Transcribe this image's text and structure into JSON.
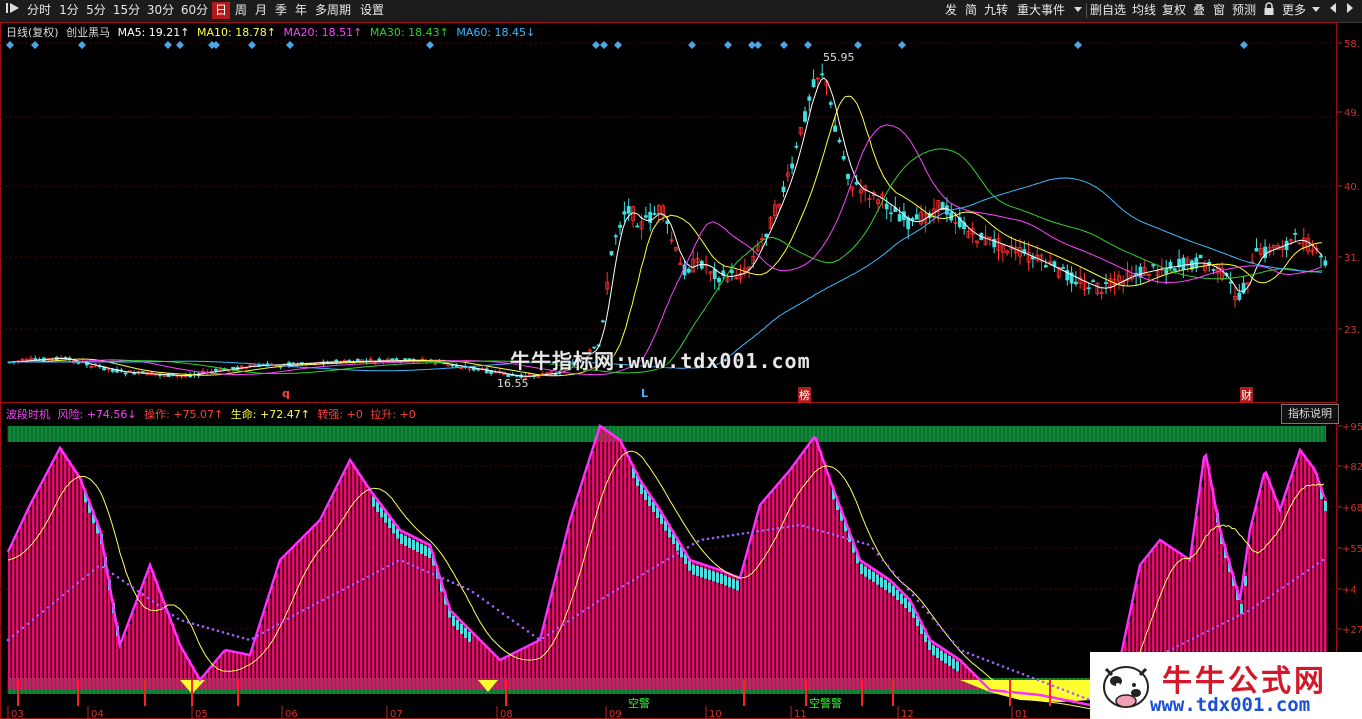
{
  "toolbar": {
    "left_icon": "play-icon",
    "periods": [
      "分时",
      "1分",
      "5分",
      "15分",
      "30分",
      "60分",
      "日",
      "周",
      "月",
      "季",
      "年",
      "多周期",
      "设置"
    ],
    "active_period": "日",
    "right_buttons": [
      "发",
      "简",
      "九转",
      "重大事件"
    ],
    "right_buttons2": [
      "删自选",
      "均线",
      "复权",
      "叠",
      "窗",
      "预测"
    ],
    "more_label": "更多"
  },
  "main_chart": {
    "title": "日线(复权)",
    "name": "创业黑马",
    "ma5": "MA5: 19.21↑",
    "ma10": "MA10: 18.78↑",
    "ma20": "MA20: 18.51↑",
    "ma30": "MA30: 18.43↑",
    "ma60": "MA60: 18.45↓",
    "high_label": "55.95",
    "low_label": "16.55",
    "price_ticks": [
      "58.",
      "49.",
      "40.",
      "31.",
      "23."
    ],
    "markers": [
      "q",
      "L",
      "榜",
      "财"
    ],
    "watermark": "牛牛指标网:www.tdx001.com"
  },
  "indicator": {
    "name": "波段时机",
    "risk": "风险: +74.56↓",
    "operate": "操作: +75.07↑",
    "life": "生命: +72.47↑",
    "strong": "转强: +0",
    "pull": "拉升: +0",
    "help_button": "指标说明",
    "right_ticks": [
      "+95",
      "+82",
      "+68",
      "+55",
      "+4",
      "+27"
    ],
    "labels": [
      "空警",
      "空警警"
    ]
  },
  "x_axis": [
    "03",
    "04",
    "05",
    "06",
    "07",
    "08",
    "09",
    "10",
    "11",
    "12",
    "01"
  ],
  "logo": {
    "title": "牛牛公式网",
    "url": "www.tdx001.com"
  },
  "colors": {
    "ma5": "#ffffff",
    "ma10": "#ffff40",
    "ma20": "#ff40ff",
    "ma30": "#30d030",
    "ma60": "#40b8ff",
    "up": "#ff3030",
    "down": "#40e0e0",
    "ind_fill": "#e0106a",
    "ind_border": "#ff30ff",
    "green_band": "#108a3a"
  },
  "chart_data": [
    {
      "type": "candlestick",
      "title": "日线(复权) 创业黑马",
      "x": [
        "03",
        "04",
        "05",
        "06",
        "07",
        "08",
        "09",
        "10",
        "11",
        "12",
        "01"
      ],
      "ylim": [
        16.55,
        58
      ],
      "series": [
        {
          "name": "close",
          "values": [
            19.5,
            19.2,
            18.6,
            19.4,
            19.8,
            17.5,
            22.0,
            40.5,
            28.0,
            50.0,
            38.5,
            32.0,
            31.0,
            30.2,
            31.5
          ]
        },
        {
          "name": "MA5",
          "values": [
            19.2,
            19.0,
            18.7,
            19.2,
            19.6,
            18.2,
            21.0,
            36.0,
            30.0,
            45.0,
            40.0,
            32.5,
            31.0,
            30.5,
            31.0
          ]
        },
        {
          "name": "MA60",
          "values": [
            19.0,
            19.0,
            19.0,
            19.1,
            19.3,
            18.8,
            19.2,
            23.0,
            27.0,
            33.0,
            38.0,
            38.0,
            36.0,
            32.5,
            31.0
          ]
        }
      ],
      "annotations": [
        "55.95",
        "16.55"
      ]
    },
    {
      "type": "bar",
      "title": "波段时机",
      "x": [
        "03",
        "04",
        "05",
        "06",
        "07",
        "08",
        "09",
        "10",
        "11",
        "12",
        "01"
      ],
      "ylim": [
        0,
        95
      ],
      "series": [
        {
          "name": "风险",
          "values": [
            60,
            88,
            35,
            55,
            40,
            85,
            70,
            30,
            15,
            50,
            55,
            95,
            75,
            60,
            45,
            92,
            75,
            55,
            40,
            30,
            20,
            5,
            0,
            0,
            30,
            55,
            60,
            85,
            50,
            80,
            74.56
          ]
        },
        {
          "name": "操作",
          "values": [
            58,
            80,
            40,
            52,
            42,
            80,
            68,
            35,
            20,
            45,
            50,
            90,
            72,
            62,
            48,
            88,
            78,
            58,
            42,
            32,
            22,
            8,
            2,
            2,
            28,
            50,
            58,
            82,
            52,
            78,
            75.07
          ]
        },
        {
          "name": "生命",
          "values": [
            20,
            25,
            30,
            32,
            35,
            40,
            42,
            44,
            30,
            28,
            30,
            40,
            45,
            48,
            52,
            55,
            58,
            60,
            55,
            45,
            30,
            15,
            5,
            5,
            15,
            25,
            35,
            45,
            52,
            60,
            72.47
          ]
        }
      ]
    }
  ]
}
